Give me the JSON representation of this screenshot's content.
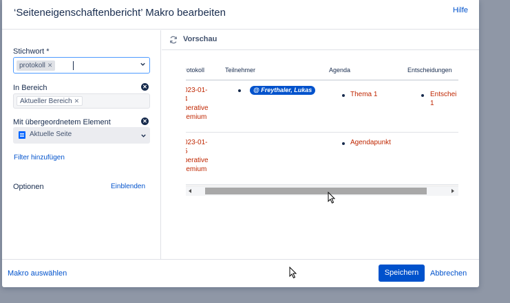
{
  "dialog": {
    "title": "‘Seiteneigenschaftenbericht’ Makro bearbeiten",
    "help": "Hilfe"
  },
  "form": {
    "keyword_label": "Stichwort *",
    "keyword_tag": "protokoll",
    "area_label": "In Bereich",
    "area_tag": "Aktueller Bereich",
    "parent_label": "Mit übergeordnetem Element",
    "parent_value": "Aktuelle Seite",
    "add_filter": "Filter hinzufügen",
    "options_label": "Optionen",
    "options_toggle": "Einblenden"
  },
  "preview": {
    "label": "Vorschau",
    "columns": [
      "rotokoll",
      "Teilnehmer",
      "Agenda",
      "Entscheidungen"
    ],
    "rows": [
      {
        "protokoll": [
          "023-01-",
          "4",
          "perative",
          "remium"
        ],
        "teilnehmer": "@ Freythaler, Lukas",
        "agenda": "Thema 1",
        "entscheidungen": [
          "Entschei",
          "1"
        ]
      },
      {
        "protokoll": [
          "023-01-",
          "5",
          "perative",
          "remium"
        ],
        "teilnehmer": "",
        "agenda": "Agendapunkt",
        "entscheidungen": []
      }
    ]
  },
  "footer": {
    "select_macro": "Makro auswählen",
    "save": "Speichern",
    "cancel": "Abbrechen"
  },
  "colors": {
    "accent": "#0052cc",
    "link_red": "#bf2600",
    "backdrop": "#8f97a6"
  }
}
